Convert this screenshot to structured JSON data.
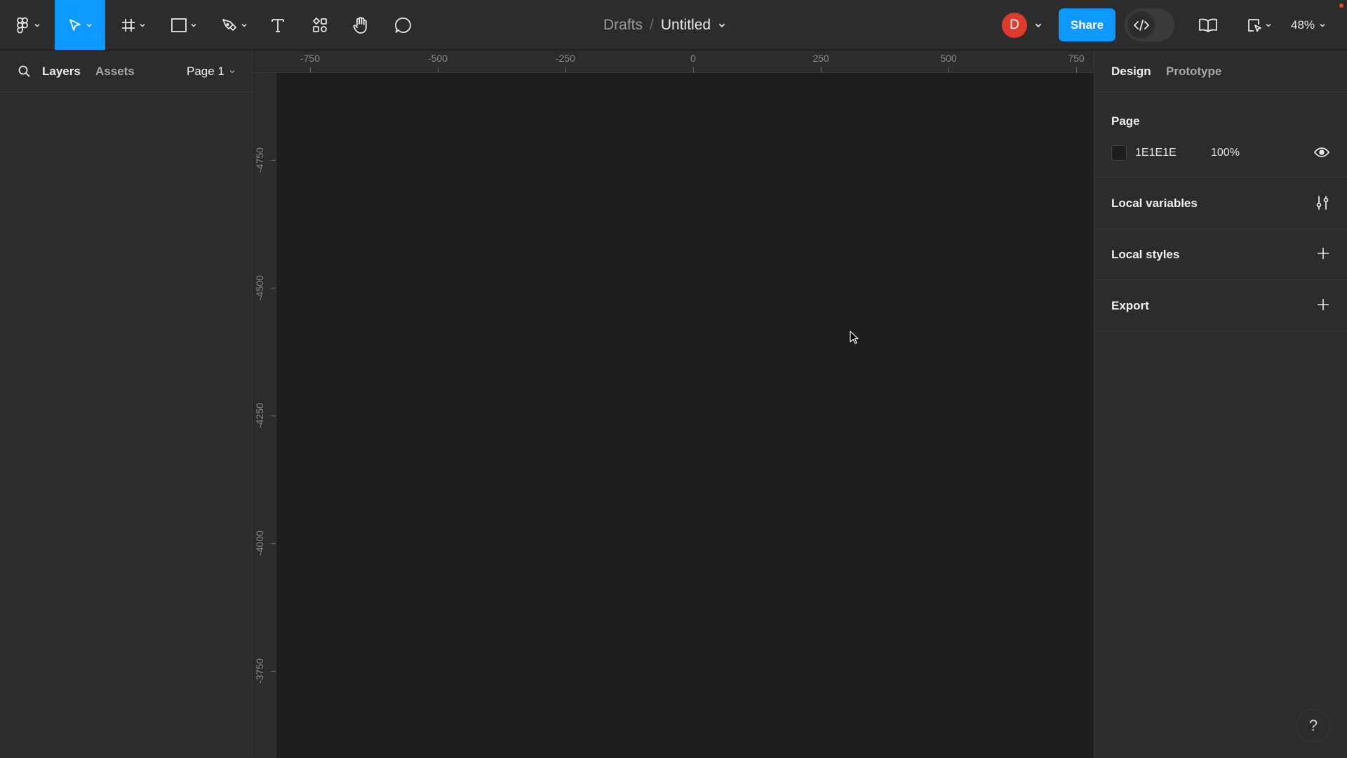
{
  "toolbar": {
    "breadcrumb_folder": "Drafts",
    "breadcrumb_separator": "/",
    "file_name": "Untitled",
    "avatar_initial": "D",
    "share_label": "Share",
    "zoom_level": "48%",
    "accent_color": "#0d99ff"
  },
  "left_panel": {
    "tab_layers": "Layers",
    "tab_assets": "Assets",
    "page_selector": "Page 1"
  },
  "rulers": {
    "top": [
      "-750",
      "-500",
      "-250",
      "0",
      "250",
      "500",
      "750"
    ],
    "left": [
      "-4750",
      "-4500",
      "-4250",
      "-4000",
      "-3750"
    ]
  },
  "right_panel": {
    "tab_design": "Design",
    "tab_prototype": "Prototype",
    "page_section_title": "Page",
    "page_color_hex": "1E1E1E",
    "page_opacity": "100%",
    "local_variables_title": "Local variables",
    "local_styles_title": "Local styles",
    "export_title": "Export"
  },
  "help_label": "?"
}
